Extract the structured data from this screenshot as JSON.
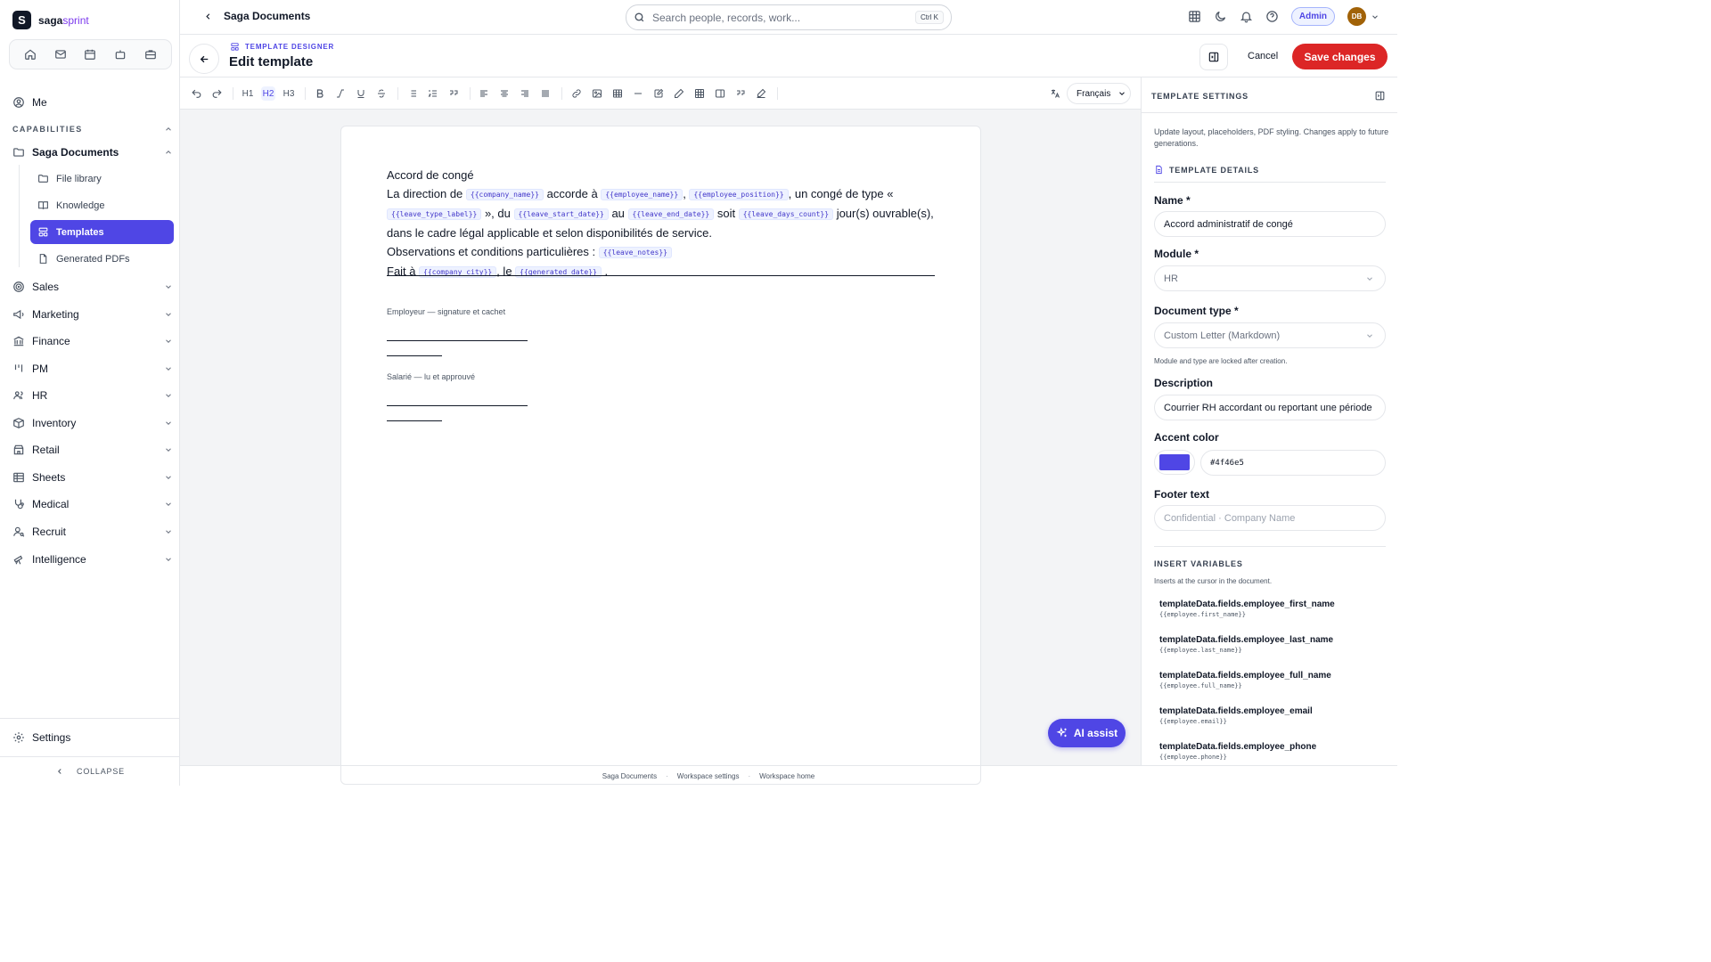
{
  "brand": {
    "name_main": "saga",
    "name_accent": "sprint",
    "mark": "S"
  },
  "quick_icons": [
    "home-icon",
    "mail-icon",
    "calendar-icon",
    "bot-icon",
    "briefcase-icon"
  ],
  "sidebar": {
    "me": "Me",
    "section": "CAPABILITIES",
    "saga_documents": "Saga Documents",
    "sub_items": [
      {
        "label": "File library",
        "icon": "folder-icon"
      },
      {
        "label": "Knowledge",
        "icon": "book-icon"
      },
      {
        "label": "Templates",
        "icon": "template-icon"
      },
      {
        "label": "Generated PDFs",
        "icon": "file-icon"
      }
    ],
    "modules": [
      {
        "label": "Sales",
        "icon": "target-icon"
      },
      {
        "label": "Marketing",
        "icon": "megaphone-icon"
      },
      {
        "label": "Finance",
        "icon": "bank-icon"
      },
      {
        "label": "PM",
        "icon": "kanban-icon"
      },
      {
        "label": "HR",
        "icon": "users-icon"
      },
      {
        "label": "Inventory",
        "icon": "box-icon"
      },
      {
        "label": "Retail",
        "icon": "store-icon"
      },
      {
        "label": "Sheets",
        "icon": "sheet-icon"
      },
      {
        "label": "Medical",
        "icon": "stethoscope-icon"
      },
      {
        "label": "Recruit",
        "icon": "user-search-icon"
      },
      {
        "label": "Intelligence",
        "icon": "telescope-icon"
      }
    ],
    "settings": "Settings",
    "collapse": "COLLAPSE"
  },
  "topbar": {
    "breadcrumb": "Saga Documents",
    "search_placeholder": "Search people, records, work...",
    "search_shortcut": "Ctrl K",
    "admin": "Admin",
    "avatar": "DB"
  },
  "header": {
    "eyebrow": "TEMPLATE DESIGNER",
    "title": "Edit template",
    "cancel": "Cancel",
    "save": "Save changes"
  },
  "toolbar": {
    "h1": "H1",
    "h2": "H2",
    "h3": "H3",
    "language": "Français"
  },
  "document": {
    "title": "Accord de congé",
    "p1_a": "La direction de",
    "var_company_name": "{{company_name}}",
    "p1_b": "accorde à",
    "var_employee_name": "{{employee_name}}",
    "p1_c": ",",
    "var_employee_position": "{{employee_position}}",
    "p1_d": ", un congé de type «",
    "var_leave_type_label": "{{leave_type_label}}",
    "p1_e": "», du",
    "var_leave_start_date": "{{leave_start_date}}",
    "p1_f": "au",
    "var_leave_end_date": "{{leave_end_date}}",
    "p1_g": "soit",
    "var_leave_days_count": "{{leave_days_count}}",
    "p1_h": "jour(s) ouvrable(s), dans le cadre légal applicable et selon disponibilités de service.",
    "p2": "Observations et conditions particulières :",
    "var_leave_notes": "{{leave_notes}}",
    "p3_a": "Fait à",
    "var_company_city": "{{company_city}}",
    "p3_b": ", le",
    "var_generated_date": "{{generated_date}}",
    "p3_c": ".",
    "sig_employer": "Employeur — signature et cachet",
    "sig_employee": "Salarié — lu et approuvé"
  },
  "ai_assist": "AI assist",
  "footer": {
    "links": [
      "Saga Documents",
      "Workspace settings",
      "Workspace home"
    ],
    "sep": "·"
  },
  "panel": {
    "title": "TEMPLATE SETTINGS",
    "intro": "Update layout, placeholders, PDF styling. Changes apply to future generations.",
    "details": "TEMPLATE DETAILS",
    "name_label": "Name *",
    "name_value": "Accord administratif de congé",
    "module_label": "Module *",
    "module_value": "HR",
    "doctype_label": "Document type *",
    "doctype_value": "Custom Letter (Markdown)",
    "locked_help": "Module and type are locked after creation.",
    "description_label": "Description",
    "description_value": "Courrier RH accordant ou reportant une période",
    "accent_label": "Accent color",
    "accent_value": "#4f46e5",
    "footer_label": "Footer text",
    "footer_placeholder": "Confidential · Company Name",
    "vars_title": "INSERT VARIABLES",
    "vars_sub": "Inserts at the cursor in the document.",
    "variables": [
      {
        "name": "templateData.fields.employee_first_name",
        "code": "{{employee.first_name}}"
      },
      {
        "name": "templateData.fields.employee_last_name",
        "code": "{{employee.last_name}}"
      },
      {
        "name": "templateData.fields.employee_full_name",
        "code": "{{employee.full_name}}"
      },
      {
        "name": "templateData.fields.employee_email",
        "code": "{{employee.email}}"
      },
      {
        "name": "templateData.fields.employee_phone",
        "code": "{{employee.phone}}"
      }
    ]
  },
  "colors": {
    "accent": "#4f46e5",
    "danger": "#dc2626"
  }
}
